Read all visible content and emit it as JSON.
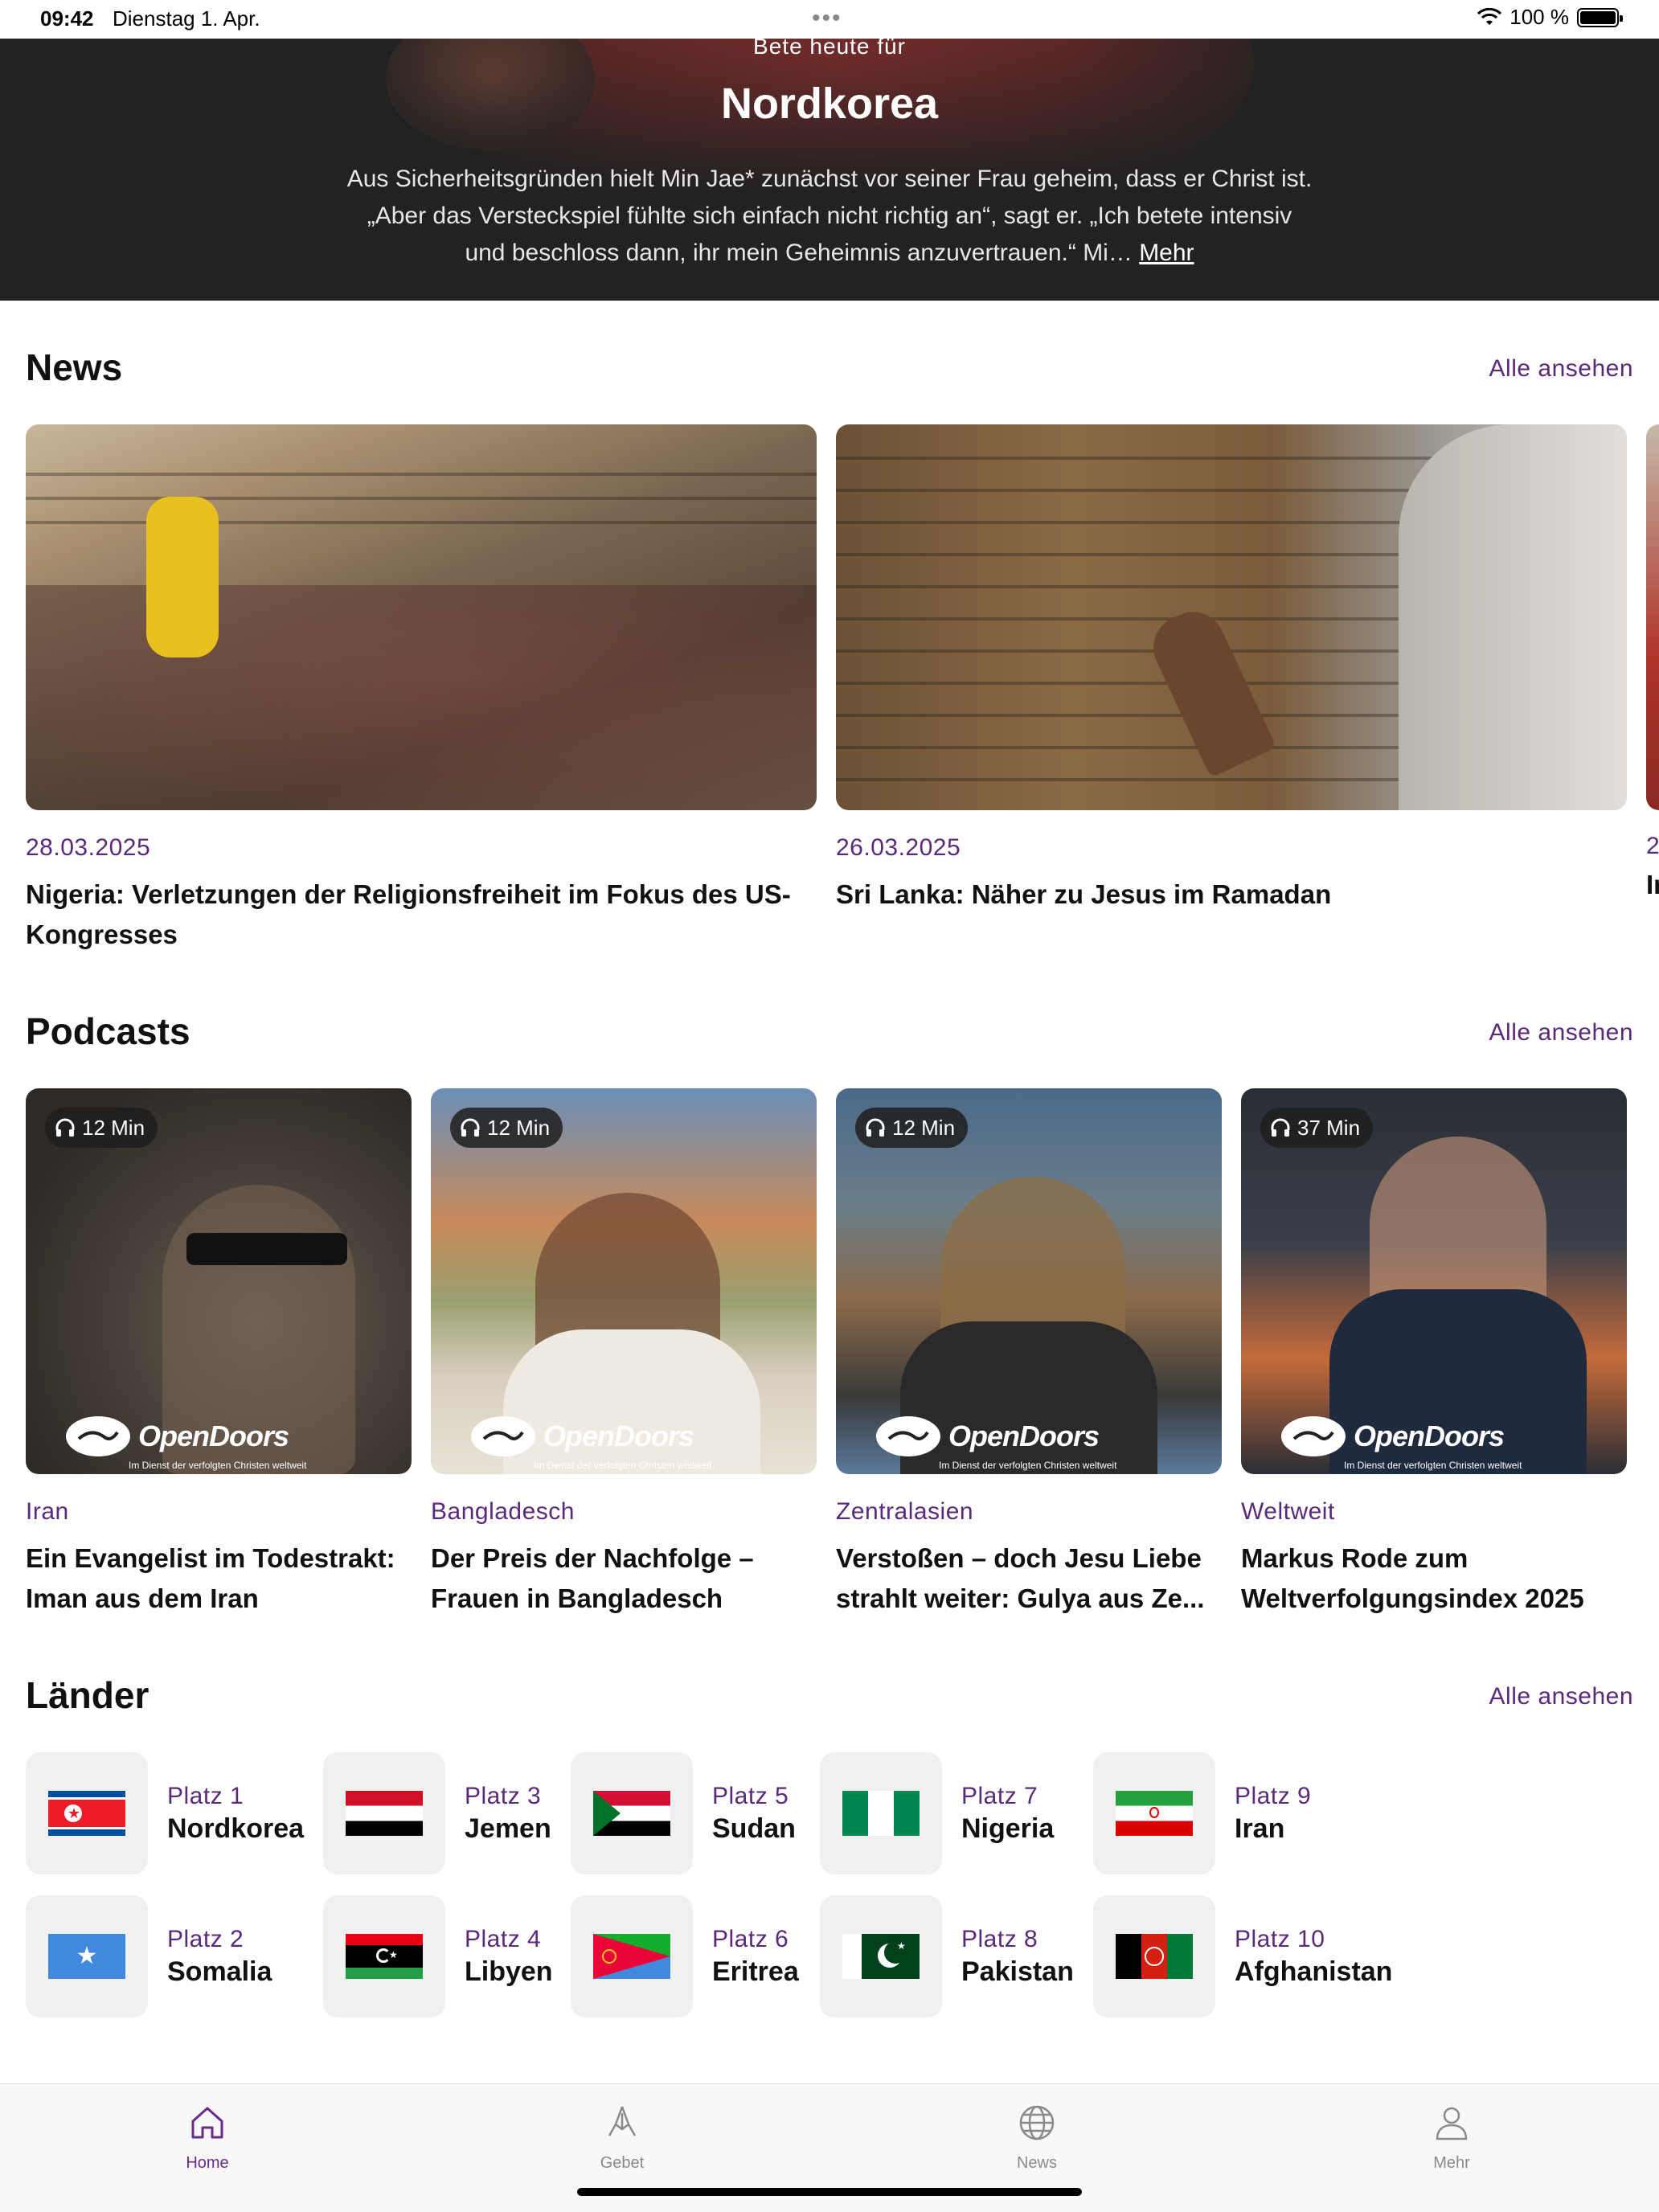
{
  "status": {
    "time": "09:42",
    "date": "Dienstag 1. Apr.",
    "battery": "100 %"
  },
  "hero": {
    "kicker": "Bete heute für",
    "title": "Nordkorea",
    "text": "Aus Sicherheitsgründen hielt Min Jae* zunächst vor seiner Frau geheim, dass er Christ ist. „Aber das Versteckspiel fühlte sich einfach nicht richtig an“, sagt er. „Ich betete intensiv und beschloss dann, ihr mein Geheimnis anzuvertrauen.“ Mi…",
    "more": "Mehr"
  },
  "news": {
    "title": "News",
    "see_all": "Alle ansehen",
    "items": [
      {
        "date": "28.03.2025",
        "title": "Nigeria: Verletzungen der Religionsfreiheit im Fokus des US-Kongresses"
      },
      {
        "date": "26.03.2025",
        "title": "Sri Lanka: Näher zu Jesus im Ramadan"
      },
      {
        "date": "2",
        "title": "Ir"
      }
    ]
  },
  "podcasts": {
    "title": "Podcasts",
    "see_all": "Alle ansehen",
    "logo_text_open": "Open",
    "logo_text_doors": "Doors",
    "logo_sub": "Im Dienst der verfolgten Christen weltweit",
    "items": [
      {
        "duration": "12 Min",
        "category": "Iran",
        "title": "Ein Evangelist im Todestrakt: Iman aus dem Iran"
      },
      {
        "duration": "12 Min",
        "category": "Bangladesch",
        "title": "Der Preis der Nachfolge – Frauen in Bangladesch"
      },
      {
        "duration": "12 Min",
        "category": "Zentralasien",
        "title": "Verstoßen – doch Jesu Liebe strahlt weiter: Gulya aus Ze..."
      },
      {
        "duration": "37 Min",
        "category": "Weltweit",
        "title": "Markus Rode zum Weltverfolgungsindex 2025"
      }
    ]
  },
  "countries": {
    "title": "Länder",
    "see_all": "Alle ansehen",
    "items": [
      {
        "rank": "Platz 1",
        "name": "Nordkorea",
        "flag": "north-korea"
      },
      {
        "rank": "Platz 3",
        "name": "Jemen",
        "flag": "yemen"
      },
      {
        "rank": "Platz 5",
        "name": "Sudan",
        "flag": "sudan"
      },
      {
        "rank": "Platz 7",
        "name": "Nigeria",
        "flag": "nigeria"
      },
      {
        "rank": "Platz 9",
        "name": "Iran",
        "flag": "iran"
      },
      {
        "rank": "Platz 2",
        "name": "Somalia",
        "flag": "somalia"
      },
      {
        "rank": "Platz 4",
        "name": "Libyen",
        "flag": "libya"
      },
      {
        "rank": "Platz 6",
        "name": "Eritrea",
        "flag": "eritrea"
      },
      {
        "rank": "Platz 8",
        "name": "Pakistan",
        "flag": "pakistan"
      },
      {
        "rank": "Platz 10",
        "name": "Afghanistan",
        "flag": "afghanistan"
      }
    ]
  },
  "tabbar": {
    "items": [
      {
        "label": "Home",
        "icon": "house-icon",
        "active": true
      },
      {
        "label": "Gebet",
        "icon": "praying-hands-icon",
        "active": false
      },
      {
        "label": "News",
        "icon": "globe-icon",
        "active": false
      },
      {
        "label": "Mehr",
        "icon": "person-icon",
        "active": false
      }
    ]
  },
  "colors": {
    "accent": "#5a2a7a",
    "hero_bg": "#222222",
    "tab_active": "#6a2a8a",
    "tab_inactive": "#8a8a8a"
  }
}
